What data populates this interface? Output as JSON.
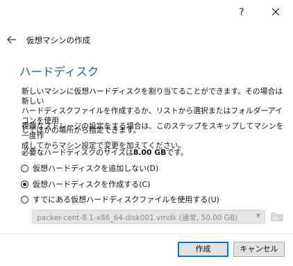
{
  "titlebar": {
    "help_label": "?",
    "close_icon": "close-icon"
  },
  "wizard": {
    "back_icon": "back-arrow-icon",
    "title": "仮想マシンの作成"
  },
  "page": {
    "title": "ハードディスク",
    "paragraph1": "新しいマシンに仮想ハードディスクを割り当てることができます。その場合は新しい\nハードディスクファイルを作成するか、リストから選択またはフォルダーアイコンを使用\nしてほかの場所から指定できます。",
    "paragraph2": "複雑なストレージの設定をする場合は、このステップをスキップしてマシンを一度作\n成してからマシン設定で変更を加えてください。",
    "size_prefix": "必要なハードディスクのサイズは",
    "size_value": "8.00 GB",
    "size_suffix": "です。"
  },
  "options": [
    {
      "label": "仮想ハードディスクを追加しない(D)",
      "checked": false
    },
    {
      "label": "仮想ハードディスクを作成する(C)",
      "checked": true
    },
    {
      "label": "すでにある仮想ハードディスクファイルを使用する(U)",
      "checked": false
    }
  ],
  "disk_select": {
    "value": "packer-cent-8.1-x86_64-disk001.vmdk (通常, 50.00 GB)",
    "arrow_icon": "chevron-down-icon",
    "folder_icon": "folder-icon"
  },
  "buttons": {
    "create": "作成",
    "cancel": "キャンセル"
  },
  "colors": {
    "title_blue": "#2b5fa8",
    "default_button_border": "#0078d7"
  }
}
